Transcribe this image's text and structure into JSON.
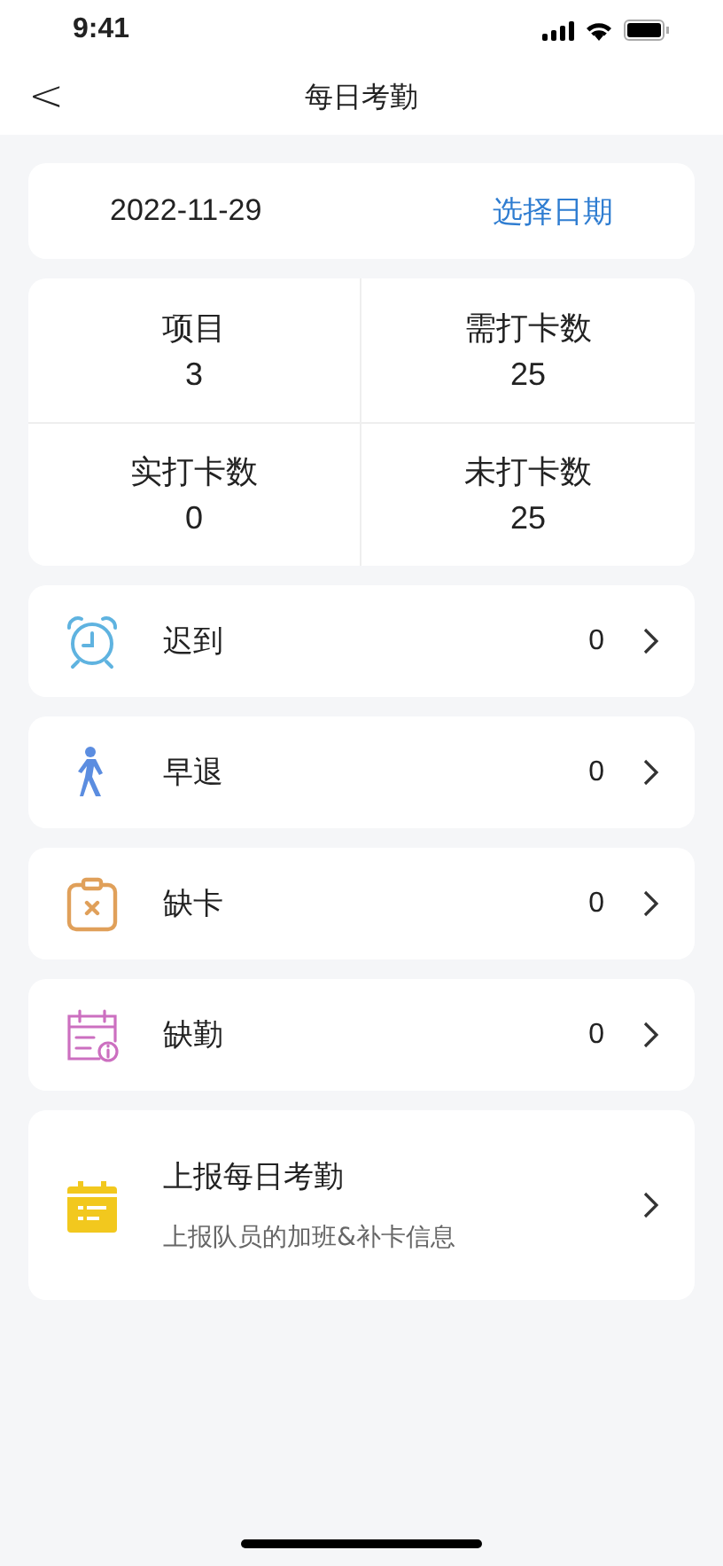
{
  "status_bar": {
    "time": "9:41"
  },
  "nav": {
    "back": "<",
    "title": "每日考勤"
  },
  "date_card": {
    "date": "2022-11-29",
    "action": "选择日期"
  },
  "stats": [
    {
      "label": "项目",
      "value": "3"
    },
    {
      "label": "需打卡数",
      "value": "25"
    },
    {
      "label": "实打卡数",
      "value": "0"
    },
    {
      "label": "未打卡数",
      "value": "25"
    }
  ],
  "rows": [
    {
      "kind": "clock",
      "label": "迟到",
      "count": "0"
    },
    {
      "kind": "walker",
      "label": "早退",
      "count": "0"
    },
    {
      "kind": "clipboard",
      "label": "缺卡",
      "count": "0"
    },
    {
      "kind": "calendar",
      "label": "缺勤",
      "count": "0"
    }
  ],
  "report": {
    "title": "上报每日考勤",
    "subtitle": "上报队员的加班&补卡信息"
  }
}
